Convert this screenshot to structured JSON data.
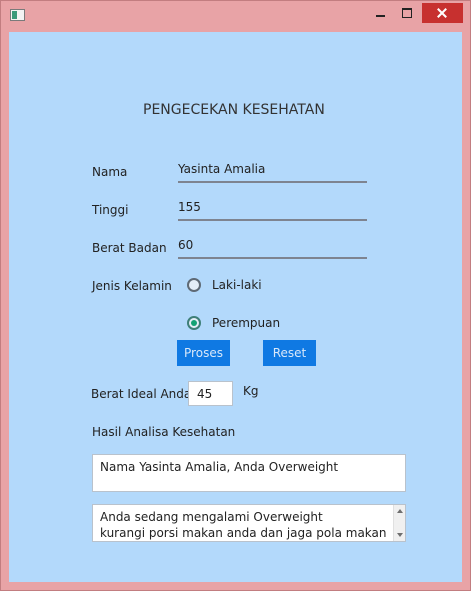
{
  "window": {
    "title": ""
  },
  "form": {
    "heading": "PENGECEKAN KESEHATAN",
    "nama_label": "Nama",
    "nama_value": "Yasinta Amalia",
    "tinggi_label": "Tinggi",
    "tinggi_value": "155",
    "berat_label": "Berat Badan",
    "berat_value": "60",
    "gender_label": "Jenis Kelamin",
    "gender_options": [
      "Laki-laki",
      "Perempuan"
    ],
    "gender_selected": "Perempuan",
    "proses_label": "Proses",
    "reset_label": "Reset",
    "ideal_label": "Berat Ideal Anda",
    "ideal_value": "45",
    "ideal_unit": "Kg",
    "hasil_label": "Hasil Analisa Kesehatan",
    "result_line": "Nama Yasinta Amalia, Anda Overweight",
    "advice_lines": [
      "Anda sedang mengalami Overweight",
      "kurangi porsi makan anda dan jaga pola makan"
    ]
  },
  "colors": {
    "accent": "#0f79e3",
    "background": "#b3d9fb",
    "radio_selected": "#13a274",
    "close": "#c7302f"
  }
}
